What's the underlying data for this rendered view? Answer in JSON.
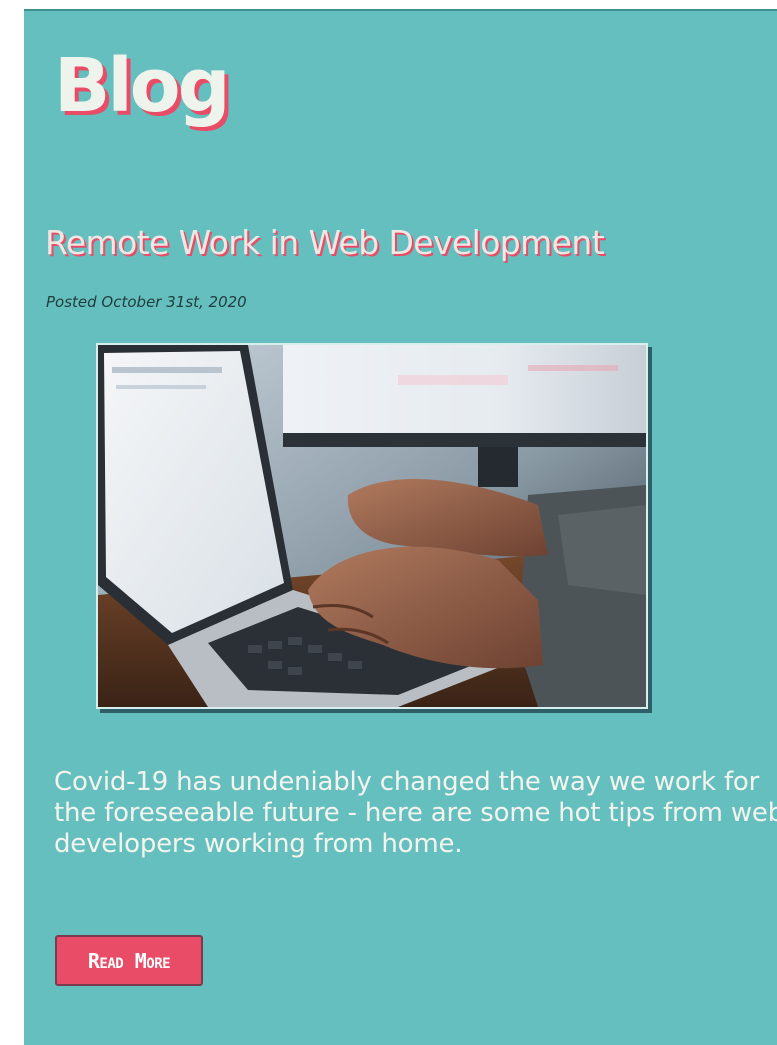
{
  "section": {
    "title": "Blog"
  },
  "post": {
    "title": "Remote Work in Web Development",
    "date": "Posted October 31st, 2020",
    "image_icon": "laptop-typing-photo",
    "excerpt": "Covid-19 has undeniably changed the way we work for the foreseeable future - here are some hot tips from web developers working from home.",
    "read_more_label": "Read More"
  },
  "colors": {
    "background": "#65BFBE",
    "accent": "#E84C66",
    "title_text": "#EEF3EC"
  }
}
